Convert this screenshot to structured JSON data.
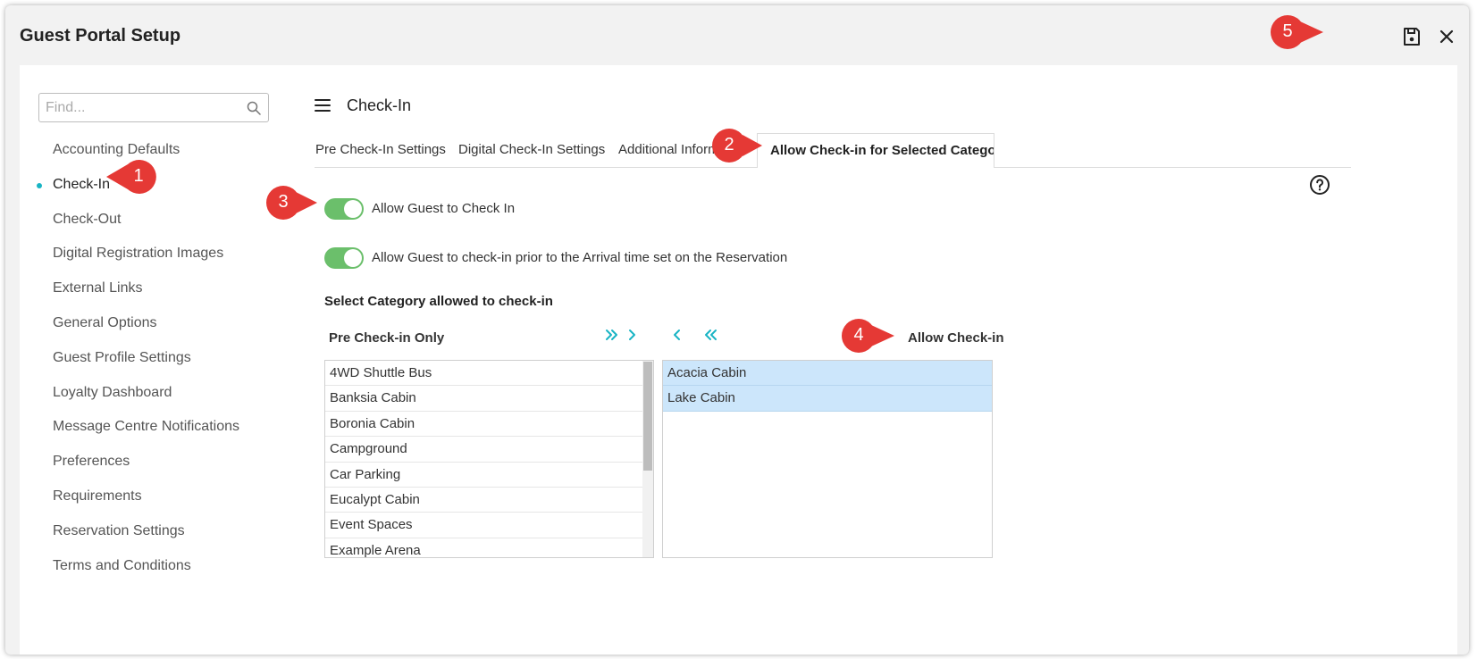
{
  "window": {
    "title": "Guest Portal Setup",
    "actions": {
      "save": "save-icon",
      "close": "close-icon"
    }
  },
  "sidebar": {
    "search_placeholder": "Find...",
    "items": [
      {
        "label": "Accounting Defaults"
      },
      {
        "label": "Check-In",
        "active": true
      },
      {
        "label": "Check-Out"
      },
      {
        "label": "Digital Registration Images"
      },
      {
        "label": "External Links"
      },
      {
        "label": "General Options"
      },
      {
        "label": "Guest Profile Settings"
      },
      {
        "label": "Loyalty Dashboard"
      },
      {
        "label": "Message Centre Notifications"
      },
      {
        "label": "Preferences"
      },
      {
        "label": "Requirements"
      },
      {
        "label": "Reservation Settings"
      },
      {
        "label": "Terms and Conditions"
      }
    ]
  },
  "main": {
    "title": "Check-In",
    "tabs": [
      {
        "label": "Pre Check-In Settings"
      },
      {
        "label": "Digital Check-In Settings"
      },
      {
        "label": "Additional Information"
      },
      {
        "label": "Allow Check-in for Selected Categories",
        "active": true
      }
    ],
    "toggles": [
      {
        "label": "Allow Guest to Check In",
        "on": true
      },
      {
        "label": "Allow Guest to check-in prior to the Arrival time set on the Reservation",
        "on": true
      }
    ],
    "section_label": "Select Category allowed to check-in",
    "left_list": {
      "header": "Pre Check-in Only",
      "items": [
        "4WD Shuttle Bus",
        "Banksia Cabin",
        "Boronia Cabin",
        "Campground",
        "Car Parking",
        "Eucalypt Cabin",
        "Event Spaces",
        "Example Arena"
      ]
    },
    "right_list": {
      "header": "Allow Check-in",
      "items": [
        "Acacia Cabin",
        "Lake Cabin"
      ]
    }
  },
  "colors": {
    "accent": "#18b4c4",
    "toggle_on": "#6bbf6b",
    "selected_row": "#cce6fb",
    "callout": "#e53935"
  },
  "callouts": [
    "1",
    "2",
    "3",
    "4",
    "5"
  ]
}
